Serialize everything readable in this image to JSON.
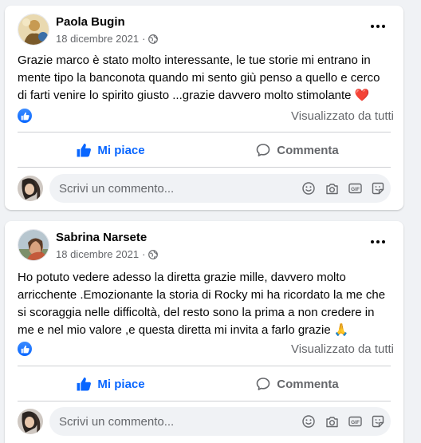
{
  "posts": [
    {
      "author": "Paola Bugin",
      "date": "18 dicembre 2021",
      "separator": "·",
      "text_lines": [
        "Grazie  marco è stato molto interessante, le tue storie mi entrano in",
        "mente tipo la banconota quando mi sento giù penso a quello e cerco",
        "di farti venire lo spirito giusto ...grazie davvero molto stimolante ❤️"
      ],
      "seen_label": "Visualizzato da tutti",
      "like_label": "Mi piace",
      "comment_label": "Commenta",
      "comment_placeholder": "Scrivi un commento..."
    },
    {
      "author": "Sabrina Narsete",
      "date": "18 dicembre 2021",
      "separator": "·",
      "text_lines": [
        "Ho potuto vedere adesso la diretta grazie mille, davvero molto",
        "arricchente .Emozionante la storia di Rocky mi ha ricordato la me che",
        "si scoraggia nelle difficoltà, del resto sono la prima a non credere in",
        "me e nel mio valore ,e questa diretta mi invita a farlo grazie 🙏"
      ],
      "seen_label": "Visualizzato da tutti",
      "like_label": "Mi piace",
      "comment_label": "Commenta",
      "comment_placeholder": "Scrivi un commento..."
    }
  ],
  "icons": {
    "privacy": "globe-icon",
    "more": "more-options-icon",
    "reaction": "like-reaction-icon",
    "like": "thumbs-up-icon",
    "comment": "speech-bubble-icon",
    "emoji": "emoji-icon",
    "camera": "camera-icon",
    "gif": "gif-icon",
    "sticker": "sticker-icon"
  },
  "colors": {
    "accent": "#0866ff",
    "secondary_text": "#65676b",
    "background": "#f0f2f5"
  }
}
